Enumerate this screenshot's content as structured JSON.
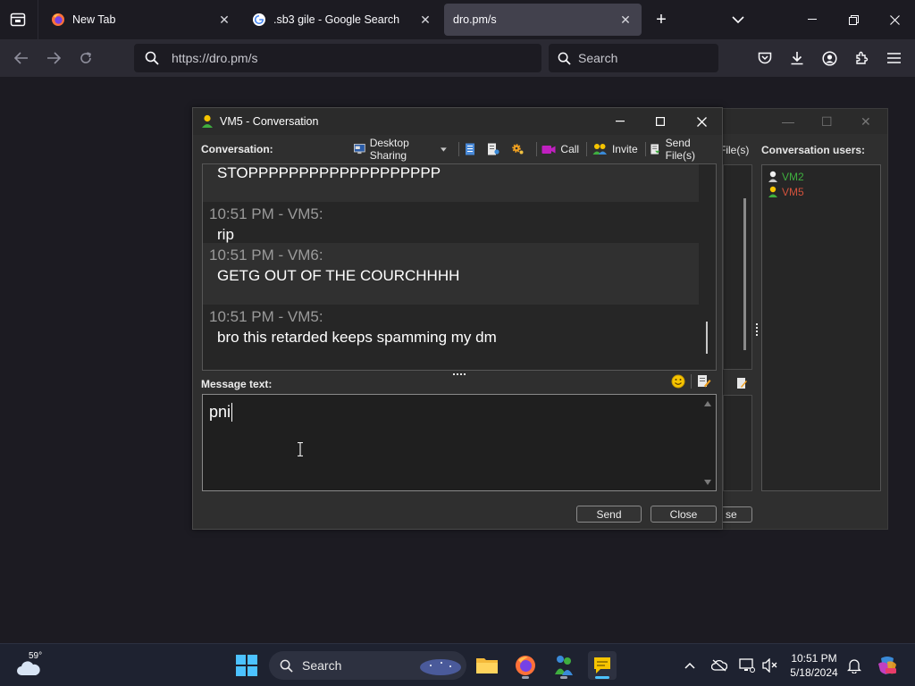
{
  "browser": {
    "tabs": [
      {
        "title": "New Tab",
        "icon": "firefox-icon",
        "active": false
      },
      {
        "title": ".sb3 gile - Google Search",
        "icon": "google-icon",
        "active": false
      },
      {
        "title": "dro.pm/s",
        "icon": "",
        "active": true
      }
    ],
    "url": "https://dro.pm/s",
    "search_placeholder": "Search"
  },
  "background_window": {
    "files_label": "File(s)",
    "users_label": "Conversation users:",
    "users": [
      {
        "name": "VM2",
        "color": "#3fae3f"
      },
      {
        "name": "VM5",
        "color": "#d2523c"
      }
    ],
    "close_partial": "se"
  },
  "window": {
    "title": "VM5 - Conversation",
    "conversation_label": "Conversation:",
    "toolbar": {
      "desktop_sharing": "Desktop Sharing",
      "call": "Call",
      "invite": "Invite",
      "send_files": "Send File(s)"
    },
    "messages": [
      {
        "header": "",
        "text": "STOPPPPPPPPPPPPPPPPPPP"
      },
      {
        "header": "10:51 PM - VM5:",
        "text": "rip"
      },
      {
        "header": "10:51 PM - VM6:",
        "text": "GETG OUT OF THE COURCHHHH"
      },
      {
        "header": "10:51 PM - VM5:",
        "text": "bro this retarded keeps spamming my dm"
      }
    ],
    "message_text_label": "Message text:",
    "message_input": "pni",
    "send_label": "Send",
    "close_label": "Close"
  },
  "taskbar": {
    "weather_temp": "59°",
    "search_label": "Search",
    "time": "10:51 PM",
    "date": "5/18/2024"
  },
  "colors": {
    "accent_yellow": "#f5c400",
    "user_green": "#3fae3f",
    "user_red": "#d2523c"
  }
}
